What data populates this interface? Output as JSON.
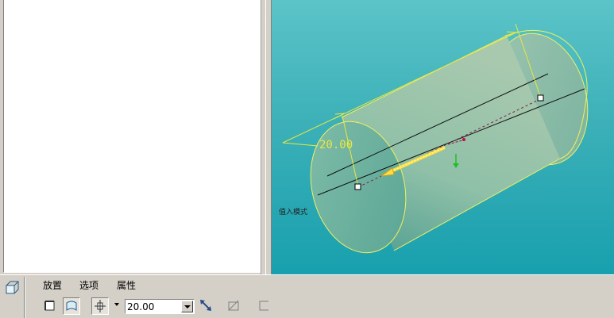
{
  "viewport": {
    "dimension_value": "20.00",
    "mode_label": "值入模式"
  },
  "dashboard": {
    "tabs": [
      {
        "label": "放置"
      },
      {
        "label": "选项"
      },
      {
        "label": "属性"
      }
    ],
    "depth": {
      "value": "20.00"
    },
    "icons": {
      "feature": "extrude-feature-icon",
      "solid": "solid-icon",
      "surface": "surface-icon",
      "depth_option": "depth-blind-icon",
      "flip": "flip-direction-icon",
      "remove_material": "remove-material-icon",
      "thicken": "thicken-sketch-icon"
    }
  },
  "colors": {
    "viewport_top": "#5bc4c8",
    "viewport_bottom": "#18a0ae",
    "edge_yellow": "#f0f060",
    "dimension_yellow": "#e8e840",
    "panel_gray": "#d4d0c8"
  }
}
